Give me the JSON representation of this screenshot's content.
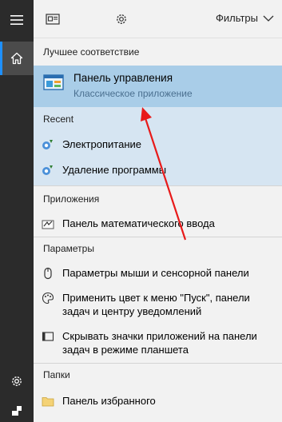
{
  "rail": {
    "hamburger_icon": "hamburger-icon",
    "home_icon": "home-icon",
    "settings_icon": "gear-icon",
    "user_icon": "user-icon"
  },
  "topbar": {
    "filters_label": "Фильтры"
  },
  "best_match": {
    "section_label": "Лучшее соответствие",
    "title": "Панель управления",
    "subtitle": "Классическое приложение"
  },
  "recent": {
    "section_label": "Recent",
    "items": [
      {
        "label": "Электропитание"
      },
      {
        "label": "Удаление программы"
      }
    ]
  },
  "apps": {
    "section_label": "Приложения",
    "items": [
      {
        "label": "Панель математического ввода"
      }
    ]
  },
  "settings": {
    "section_label": "Параметры",
    "items": [
      {
        "label": "Параметры мыши и сенсорной панели"
      },
      {
        "label": "Применить цвет к меню \"Пуск\", панели задач и центру уведомлений"
      },
      {
        "label": "Скрывать значки приложений на панели задач в режиме планшета"
      }
    ]
  },
  "folders": {
    "section_label": "Папки",
    "items": [
      {
        "label": "Панель избранного"
      }
    ]
  },
  "colors": {
    "rail_bg": "#2b2b2b",
    "selected_bg": "#a9cde8",
    "recent_bg": "#d6e5f2",
    "arrow": "#e81a1a"
  }
}
